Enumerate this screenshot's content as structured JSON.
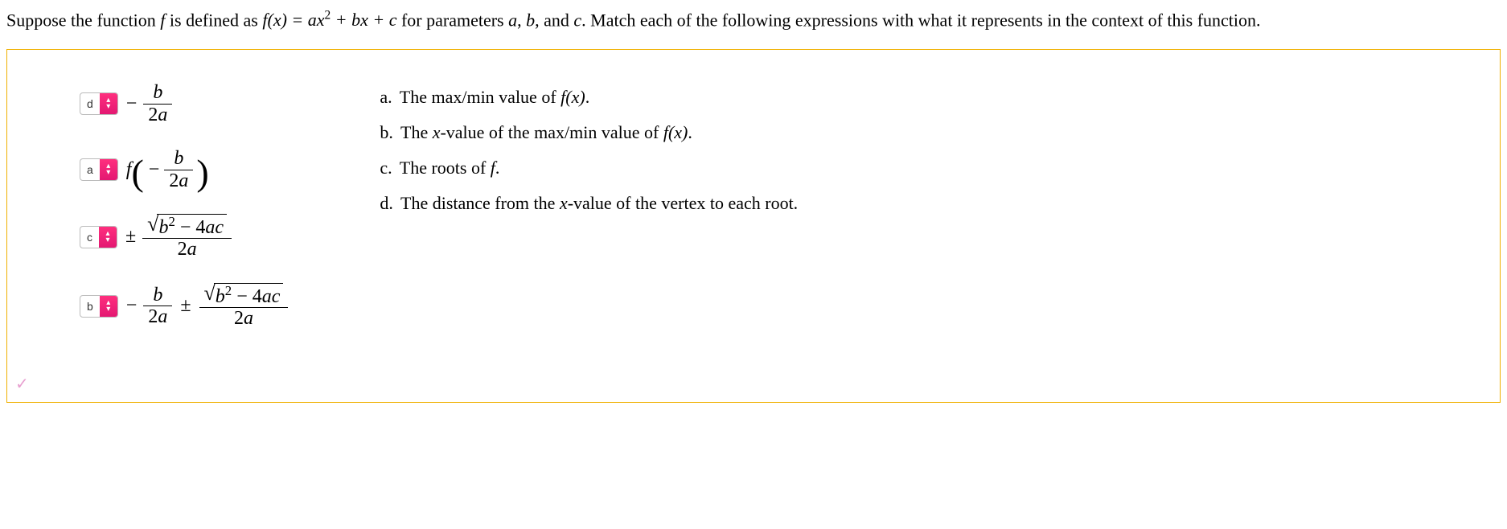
{
  "prompt": {
    "part1": "Suppose the function ",
    "fn": "f",
    "part2": " is defined as ",
    "equation": "f(x) = ax² + bx + c",
    "part3": " for parameters ",
    "params": "a, b, and c.",
    "part4": " Match each of the following expressions with what it represents in the context of this function."
  },
  "matches": [
    {
      "selected": "d"
    },
    {
      "selected": "a"
    },
    {
      "selected": "c"
    },
    {
      "selected": "b"
    }
  ],
  "expressions": {
    "e1_minus": "−",
    "e1_num": "b",
    "e1_den": "2a",
    "e2_f": "f",
    "e2_minus": "−",
    "e2_num": "b",
    "e2_den": "2a",
    "e3_pm": "±",
    "e3_radicand": "b² − 4ac",
    "e3_den": "2a",
    "e4_minus": "−",
    "e4_num1": "b",
    "e4_den1": "2a",
    "e4_pm": "±",
    "e4_radicand": "b² − 4ac",
    "e4_den2": "2a"
  },
  "options": [
    {
      "label": "a.",
      "text_pre": "The max/min value of ",
      "fx": "f(x)",
      "text_post": "."
    },
    {
      "label": "b.",
      "text_pre": "The ",
      "xval": "x",
      "text_mid": "-value of the max/min value of ",
      "fx": "f(x)",
      "text_post": "."
    },
    {
      "label": "c.",
      "text_pre": "The roots of ",
      "fx": "f",
      "text_post": "."
    },
    {
      "label": "d.",
      "text_pre": "The distance from the ",
      "xval": "x",
      "text_mid": "-value of the vertex to each root.",
      "fx": "",
      "text_post": ""
    }
  ],
  "icons": {
    "check": "✓"
  }
}
